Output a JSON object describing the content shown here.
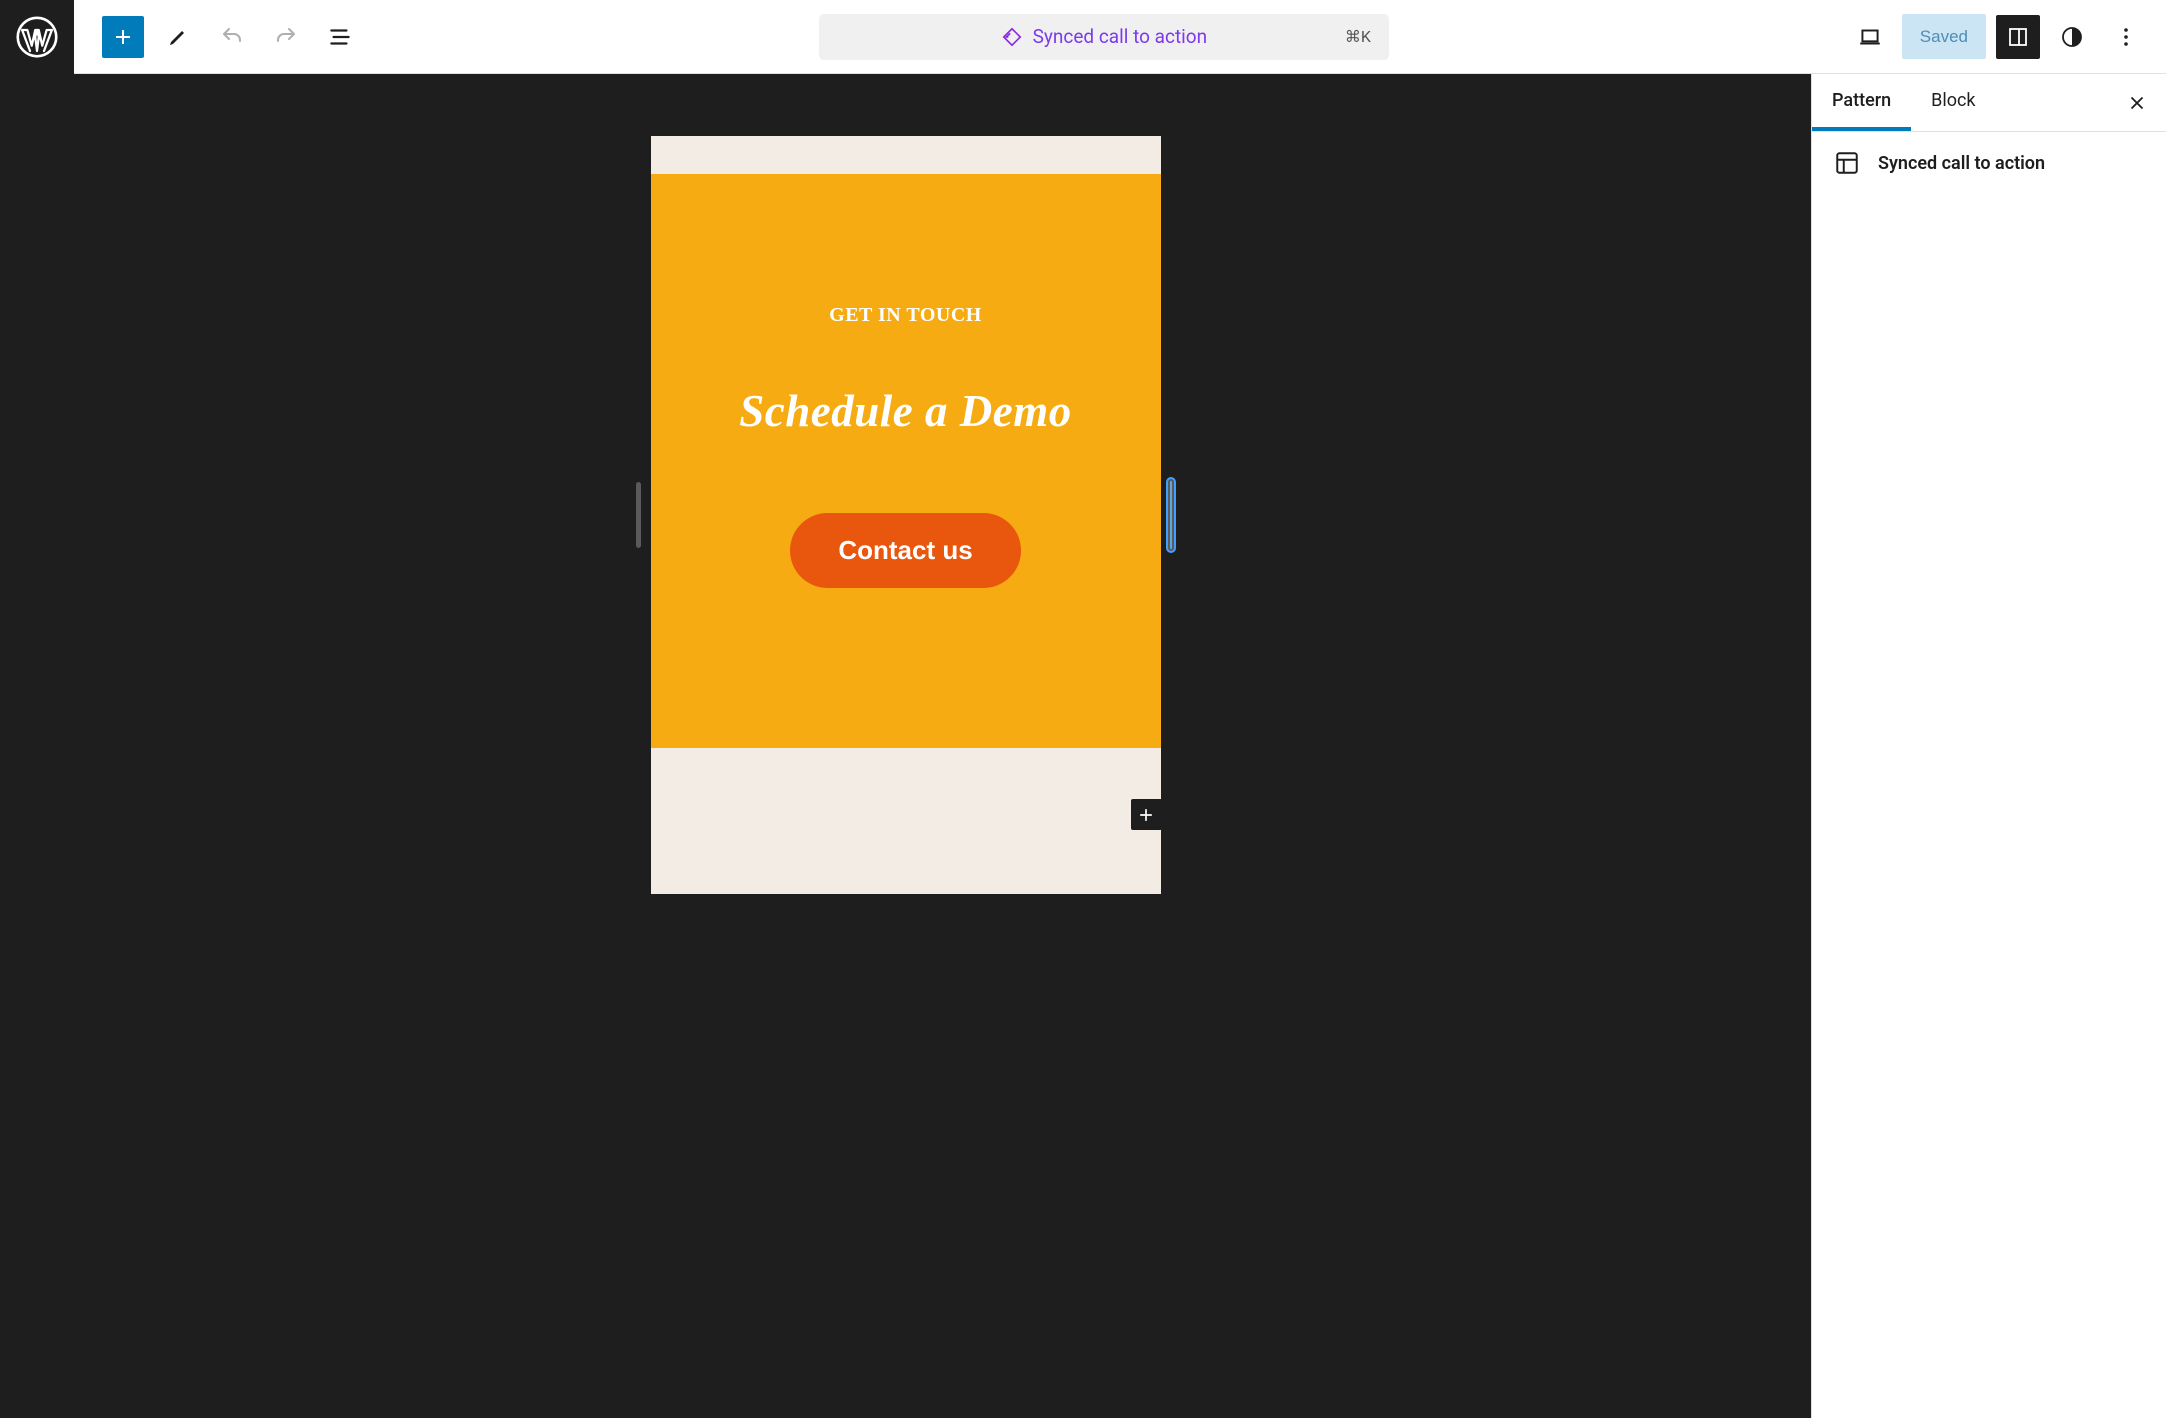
{
  "toolbar": {
    "document_title": "Synced call to action",
    "shortcut": "⌘K",
    "saved_label": "Saved"
  },
  "canvas": {
    "eyebrow": "GET IN TOUCH",
    "headline": "Schedule a Demo",
    "button_label": "Contact us"
  },
  "sidebar": {
    "tabs": [
      {
        "label": "Pattern",
        "active": true
      },
      {
        "label": "Block",
        "active": false
      }
    ],
    "panel_title": "Synced call to action"
  }
}
